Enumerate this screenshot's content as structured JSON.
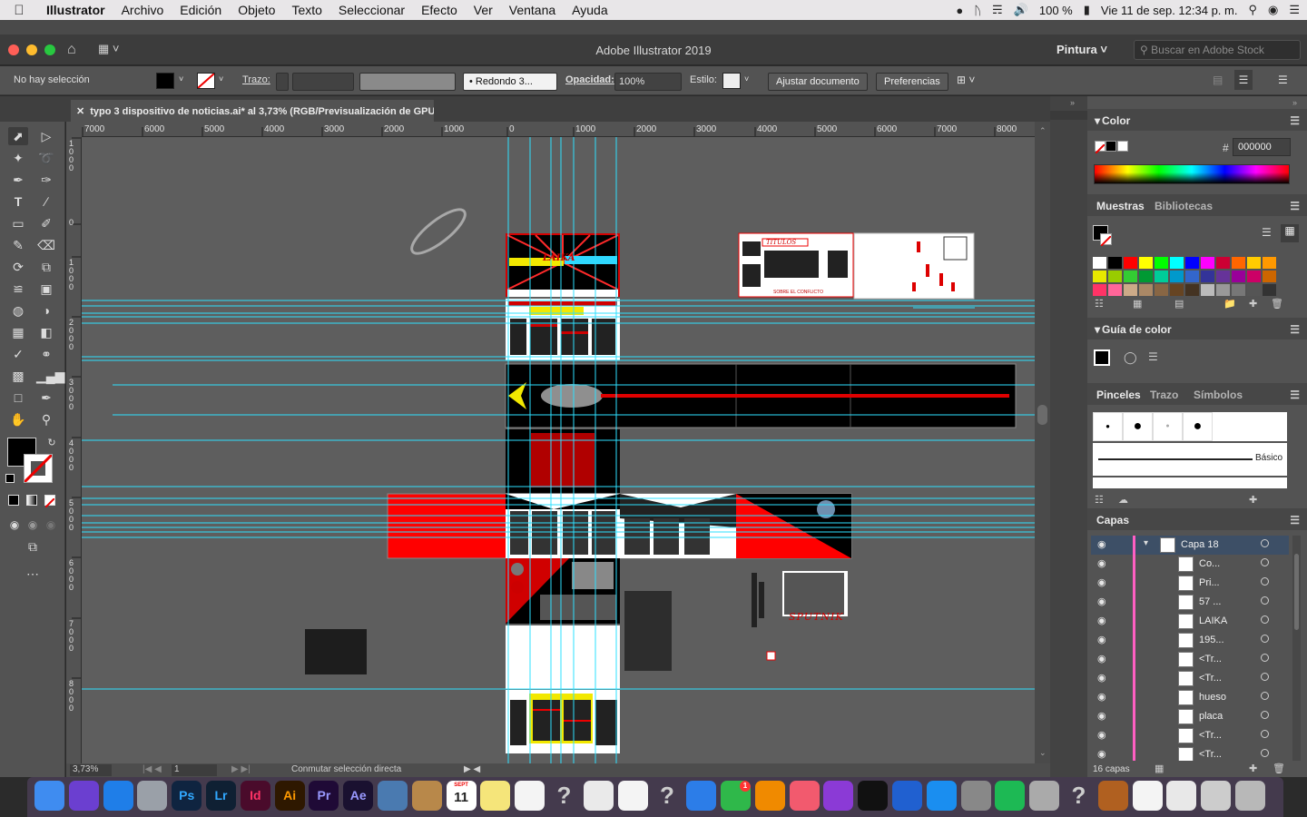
{
  "menubar": {
    "app_name": "Illustrator",
    "menus": [
      "Archivo",
      "Edición",
      "Objeto",
      "Texto",
      "Seleccionar",
      "Efecto",
      "Ver",
      "Ventana",
      "Ayuda"
    ],
    "battery": "100 %",
    "datetime": "Vie 11 de sep.  12:34 p. m."
  },
  "window": {
    "title": "Adobe Illustrator 2019",
    "workspace": "Pintura",
    "stock_search_placeholder": "Buscar en Adobe Stock"
  },
  "control_bar": {
    "selection_status": "No hay selección",
    "stroke_label": "Trazo:",
    "brush_value": "Redondo 3...",
    "opacity_label": "Opacidad:",
    "opacity_value": "100%",
    "style_label": "Estilo:",
    "fit_document_button": "Ajustar documento",
    "preferences_button": "Preferencias"
  },
  "document_tab": {
    "title": "typo 3 dispositivo de noticias.ai* al 3,73% (RGB/Previsualización de GPU)"
  },
  "rulers": {
    "top_ticks": [
      "7000",
      "6000",
      "5000",
      "4000",
      "3000",
      "2000",
      "1000",
      "0",
      "1000",
      "2000",
      "3000",
      "4000",
      "5000",
      "6000",
      "7000",
      "8000"
    ],
    "left_ticks": [
      "1000",
      "0",
      "1000",
      "2000",
      "3000",
      "4000",
      "5000",
      "6000",
      "7000",
      "8000"
    ]
  },
  "status_bar": {
    "zoom": "3,73%",
    "artboard": "1",
    "tool_hint": "Conmutar selección directa"
  },
  "panels": {
    "color": {
      "title": "Color",
      "hex_label": "#",
      "hex_value": "000000"
    },
    "swatches": {
      "tab_active": "Muestras",
      "tab_other": "Bibliotecas",
      "colors": [
        "#ffffff",
        "#000000",
        "#ff0000",
        "#ffff00",
        "#00ff00",
        "#00ffff",
        "#0000ff",
        "#ff00ff",
        "#cc0033",
        "#ff6600",
        "#ffcc00",
        "#ff9900",
        "#e8e800",
        "#99cc00",
        "#33cc33",
        "#009933",
        "#00cc99",
        "#0099cc",
        "#3366cc",
        "#333399",
        "#663399",
        "#990099",
        "#cc0066",
        "#cc6600",
        "#ff3366",
        "#ff6699",
        "#ccaa88",
        "#aa8866",
        "#886644",
        "#664422",
        "#443322",
        "#bbbbbb",
        "#999999",
        "#777777",
        "#555555",
        "#333333"
      ]
    },
    "color_guide": {
      "title": "Guía de color"
    },
    "brushes": {
      "tab_active": "Pinceles",
      "tab_stroke": "Trazo",
      "tab_symbols": "Símbolos",
      "basic_label": "Básico"
    },
    "layers": {
      "title": "Capas",
      "count": "16 capas",
      "rows": [
        {
          "name": "Capa 18"
        },
        {
          "name": "Co..."
        },
        {
          "name": "Pri..."
        },
        {
          "name": "57 ..."
        },
        {
          "name": "LAIKA"
        },
        {
          "name": "195..."
        },
        {
          "name": "<Tr..."
        },
        {
          "name": "<Tr..."
        },
        {
          "name": "hueso"
        },
        {
          "name": "placa"
        },
        {
          "name": "<Tr..."
        },
        {
          "name": "<Tr..."
        }
      ]
    }
  },
  "canvas_text": {
    "sputnik": "SPUTNIK",
    "laika": "LAIKA",
    "titulos": "TITULOS",
    "subtitle": "SOBRE EL CONFLICTO"
  },
  "dock": {
    "apps": [
      "Finder",
      "Siri",
      "Safari",
      "Launchpad",
      "Ps",
      "Lr",
      "Id",
      "Ai",
      "Pr",
      "Ae",
      "Preview",
      "Contacts",
      "Calendar",
      "Notes",
      "Reminders",
      "?",
      "Photos Booth",
      "Photos",
      "?",
      "Messages",
      "FaceTime",
      "VLC",
      "Music",
      "Podcasts",
      "TV",
      "TeamViewer",
      "App Store",
      "System Preferences",
      "Spotify",
      "Printer",
      "?",
      "Guitar",
      "TextEdit",
      "Chrome",
      "Image Capture",
      "Trash"
    ],
    "calendar_month": "SEPT",
    "calendar_day": "11",
    "facetime_badge": "1"
  }
}
